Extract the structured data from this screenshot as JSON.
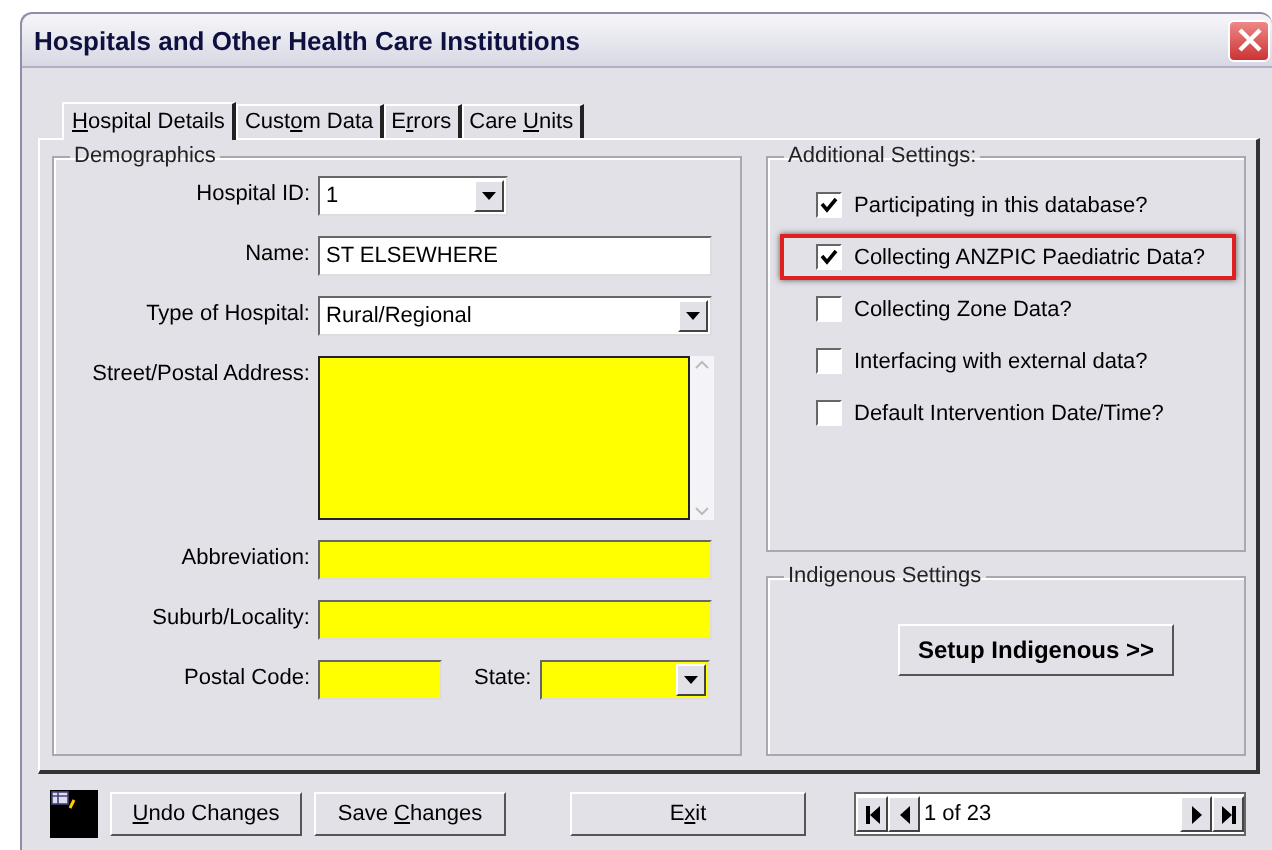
{
  "window": {
    "title": "Hospitals and Other Health Care Institutions"
  },
  "tabs": [
    {
      "label": {
        "key": "H",
        "after": "ospital Details"
      },
      "selected": true
    },
    {
      "label": {
        "before": "Cust",
        "key": "o",
        "after": "m Data"
      },
      "selected": false
    },
    {
      "label": {
        "before": "E",
        "key": "r",
        "after": "rors"
      },
      "selected": false
    },
    {
      "label": {
        "before": "Care ",
        "key": "U",
        "after": "nits"
      },
      "selected": false
    }
  ],
  "demographics": {
    "title": "Demographics",
    "rows": [
      {
        "items": [
          {
            "kind": "combo",
            "label": "Hospital ID:",
            "value": "1",
            "required": false
          }
        ]
      },
      {
        "items": [
          {
            "kind": "text",
            "label": "Name:",
            "value": "ST ELSEWHERE",
            "required": false
          }
        ]
      },
      {
        "items": [
          {
            "kind": "combo",
            "label": "Type of Hospital:",
            "value": "Rural/Regional",
            "required": false
          }
        ]
      },
      {
        "items": [
          {
            "kind": "memo",
            "label": "Street/Postal Address:",
            "required": true
          }
        ]
      },
      {
        "items": [
          {
            "kind": "text",
            "label": "Abbreviation:",
            "required": true
          }
        ]
      },
      {
        "items": [
          {
            "kind": "text",
            "label": "Suburb/Locality:",
            "required": true
          }
        ]
      },
      {
        "items": [
          {
            "kind": "text",
            "label": "Postal Code:",
            "required": true
          },
          {
            "kind": "combo",
            "label": "State:",
            "required": true
          }
        ]
      }
    ]
  },
  "additional_settings": {
    "title": "Additional Settings:",
    "options": [
      {
        "label": "Participating in this database?",
        "checked": true,
        "highlighted": false
      },
      {
        "label": "Collecting ANZPIC Paediatric Data?",
        "checked": true,
        "highlighted": true
      },
      {
        "label": "Collecting Zone Data?",
        "checked": false,
        "highlighted": false
      },
      {
        "label": "Interfacing with external data?",
        "checked": false,
        "highlighted": false
      },
      {
        "label": "Default Intervention Date/Time?",
        "checked": false,
        "highlighted": false
      }
    ]
  },
  "indigenous_settings": {
    "title": "Indigenous Settings",
    "button": "Setup Indigenous >>"
  },
  "bottom_buttons": [
    {
      "label": {
        "key": "U",
        "after": "ndo Changes"
      }
    },
    {
      "label": {
        "before": "Save ",
        "key": "C",
        "after": "hanges"
      }
    },
    {
      "label": {
        "before": "E",
        "key": "x",
        "after": "it"
      }
    }
  ],
  "navigator": {
    "text": "1 of 23"
  }
}
